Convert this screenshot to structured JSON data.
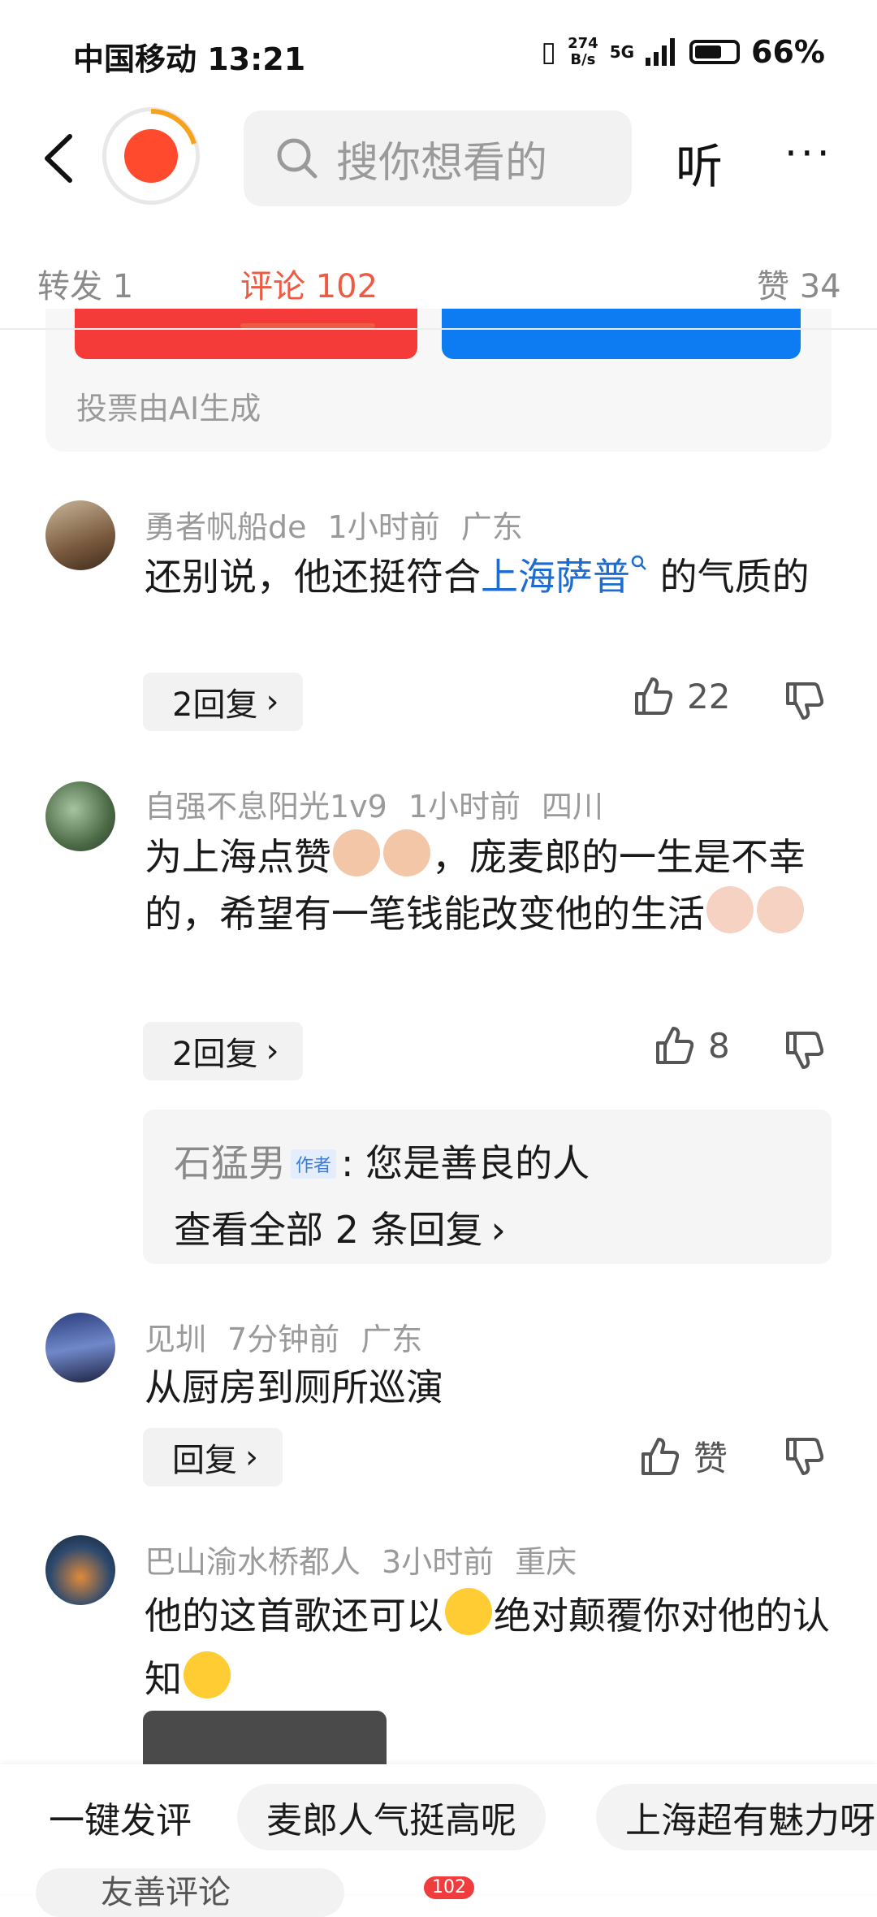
{
  "status_bar": {
    "carrier_time": "中国移动 13:21",
    "net_speed_top": "274",
    "net_speed_bottom": "B/s",
    "signal": "5G",
    "battery": "66%",
    "battery_level": 0.66
  },
  "nav": {
    "search_placeholder": "搜你想看的",
    "listen_label": "听",
    "more_label": "···"
  },
  "tabs": [
    {
      "label": "转发 1"
    },
    {
      "label": "评论 102"
    },
    {
      "label": "赞 34"
    }
  ],
  "vote_note": "投票由AI生成",
  "comments": [
    {
      "user": "勇者帆船de",
      "time": "1小时前",
      "location": "广东",
      "text_before": "还别说，他还挺符合",
      "link": "上海萨普",
      "text_after": "的气质的",
      "reply_label": "2回复",
      "likes": "22"
    },
    {
      "user": "自强不息阳光1v9",
      "time": "1小时前",
      "location": "四川",
      "text_a": "为上海点赞",
      "text_b": "，庞麦郎的一生是不幸的，希望有一笔钱能改变他的生活",
      "reply_label": "2回复",
      "likes": "8",
      "sub_reply": {
        "author": "石猛男",
        "tag": "作者",
        "text": ": 您是善良的人",
        "view_all": "查看全部 2 条回复"
      }
    },
    {
      "user": "见圳",
      "time": "7分钟前",
      "location": "广东",
      "text": "从厨房到厕所巡演",
      "reply_label": "回复",
      "likes": "赞"
    },
    {
      "user": "巴山渝水桥都人",
      "time": "3小时前",
      "location": "重庆",
      "text_a": "他的这首歌还可以",
      "text_b": "绝对颠覆你对他的认知"
    }
  ],
  "quick_replies": [
    "一键发评",
    "麦郎人气挺高呢",
    "上海超有魅力呀"
  ],
  "compose": {
    "placeholder": "友善评论",
    "comment_badge": "102"
  },
  "colors": {
    "accent": "#ef5a42",
    "link": "#1f6cd1",
    "vote_red": "#f53a3a",
    "vote_blue": "#0d7cf2"
  }
}
